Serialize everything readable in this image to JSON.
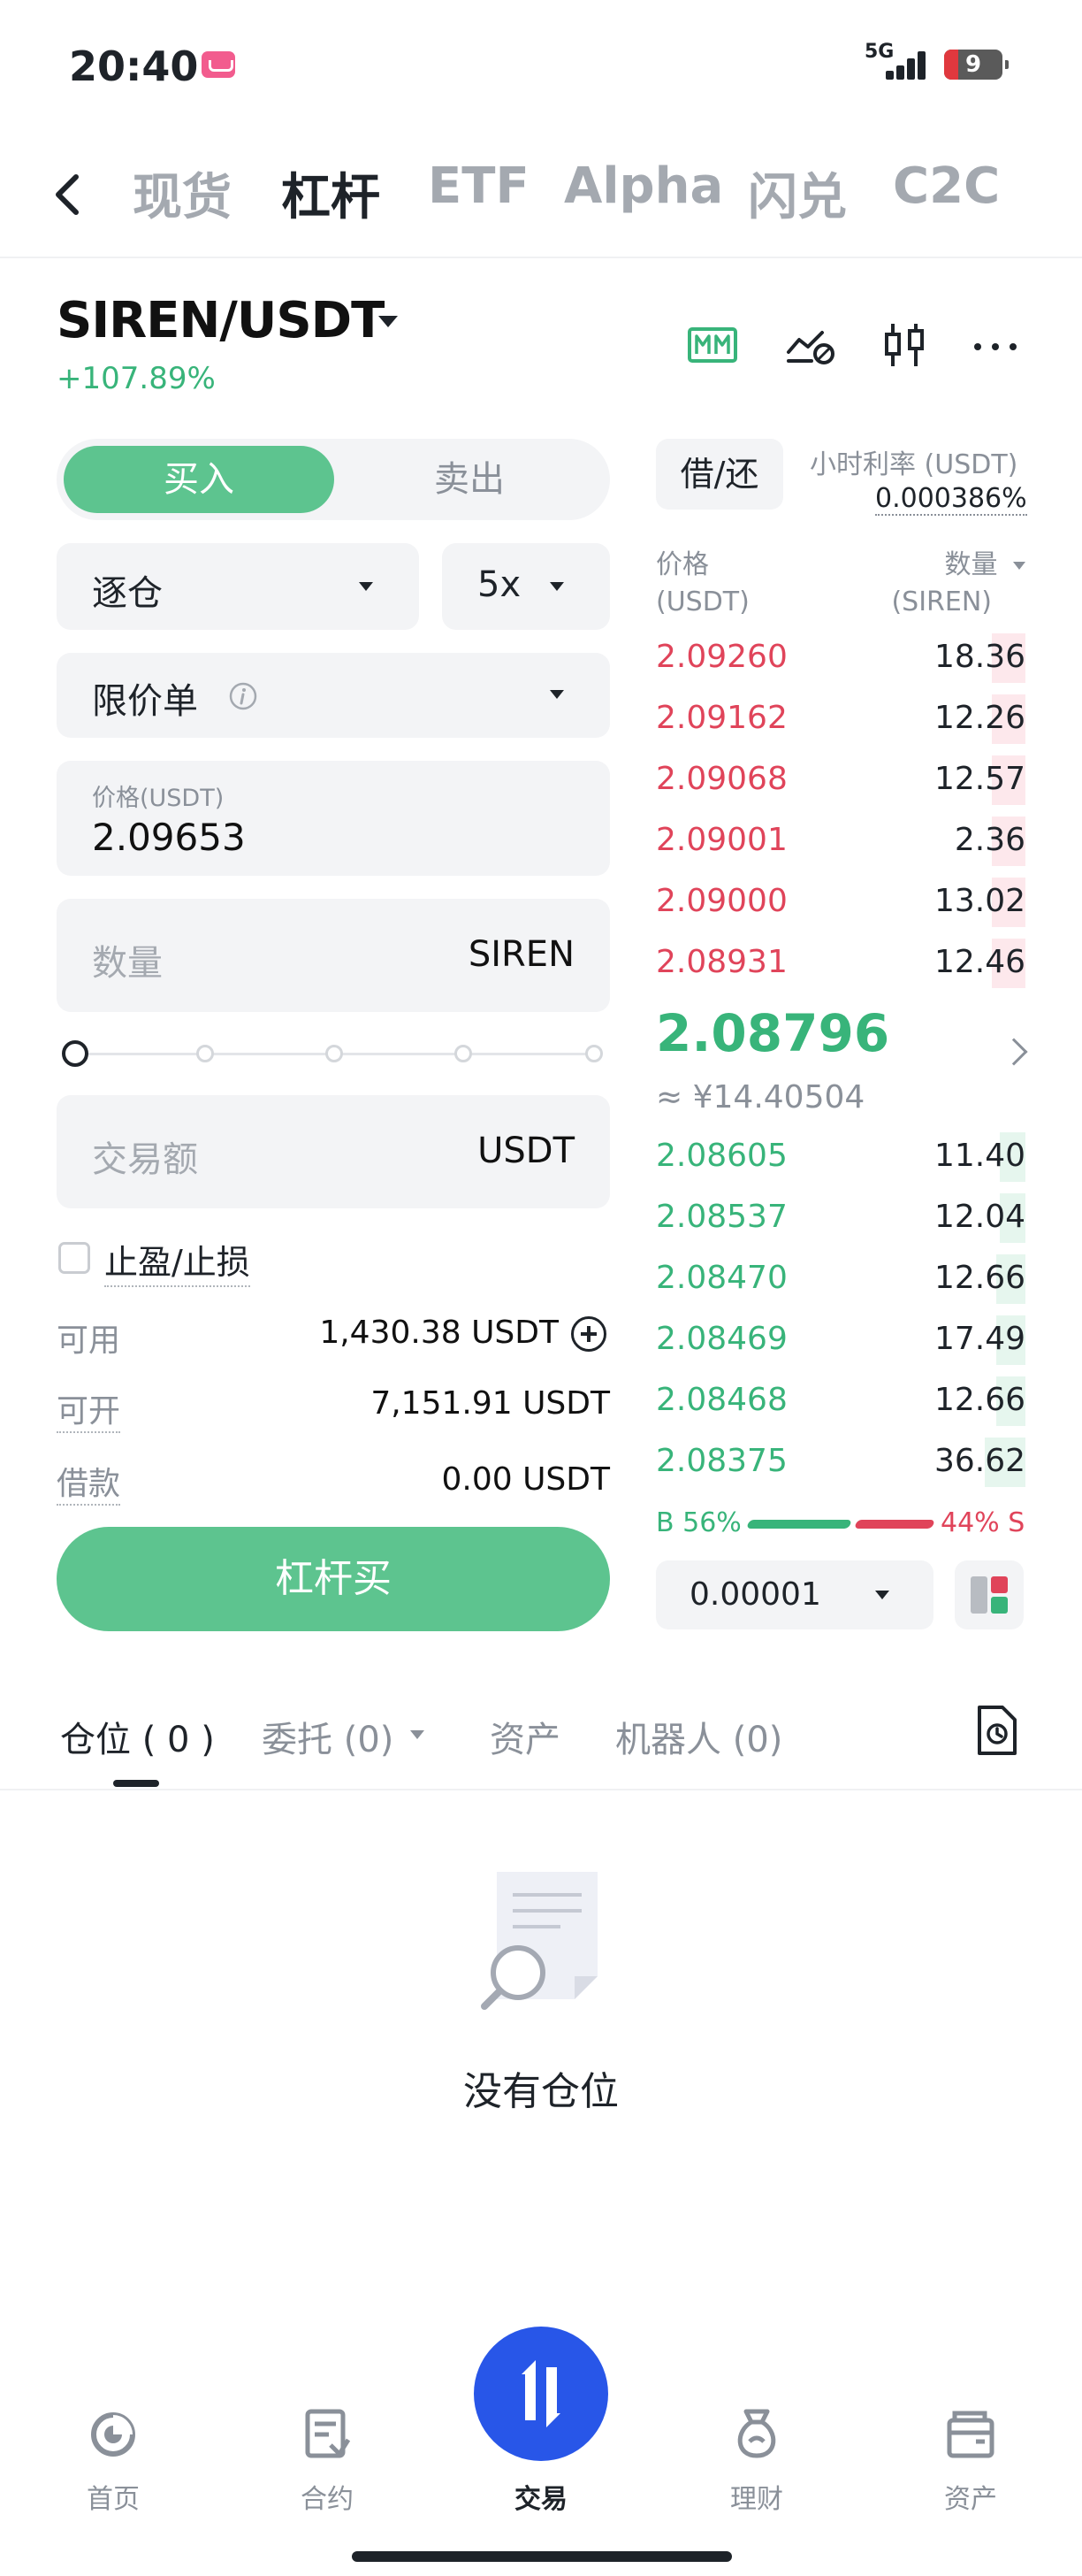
{
  "status_bar": {
    "time": "20:40",
    "network": "5G",
    "battery": "9"
  },
  "top_nav": {
    "tabs": [
      {
        "label": "现货",
        "active": false
      },
      {
        "label": "杠杆",
        "active": true
      },
      {
        "label": "ETF",
        "active": false
      },
      {
        "label": "Alpha",
        "active": false
      },
      {
        "label": "闪兑",
        "active": false
      },
      {
        "label": "C2C",
        "active": false
      }
    ]
  },
  "pair": {
    "symbol": "SIREN/USDT",
    "change": "+107.89%"
  },
  "order_form": {
    "side_buy": "买入",
    "side_sell": "卖出",
    "margin_mode": "逐仓",
    "leverage": "5x",
    "order_type": "限价单",
    "price_label": "价格(USDT)",
    "price_value": "2.09653",
    "qty_placeholder": "数量",
    "qty_unit": "SIREN",
    "amount_placeholder": "交易额",
    "amount_unit": "USDT",
    "tpsl_label": "止盈/止损",
    "available_label": "可用",
    "available_value": "1,430.38 USDT",
    "openable_label": "可开",
    "openable_value": "7,151.91 USDT",
    "loan_label": "借款",
    "loan_value": "0.00 USDT",
    "submit_label": "杠杆买"
  },
  "order_book": {
    "borrow_label": "借/还",
    "rate_label": "小时利率 (USDT)",
    "rate_value": "0.000386%",
    "price_header": "价格",
    "price_header_unit": "(USDT)",
    "qty_header": "数量",
    "qty_header_unit": "(SIREN)",
    "asks": [
      {
        "price": "2.09260",
        "qty": "18.36",
        "depth": 0.09
      },
      {
        "price": "2.09162",
        "qty": "12.26",
        "depth": 0.09
      },
      {
        "price": "2.09068",
        "qty": "12.57",
        "depth": 0.09
      },
      {
        "price": "2.09001",
        "qty": "2.36",
        "depth": 0.09
      },
      {
        "price": "2.09000",
        "qty": "13.02",
        "depth": 0.09
      },
      {
        "price": "2.08931",
        "qty": "12.46",
        "depth": 0.09
      }
    ],
    "mid_price": "2.08796",
    "mid_price_cny": "≈ ¥14.40504",
    "bids": [
      {
        "price": "2.08605",
        "qty": "11.40",
        "depth": 0.07
      },
      {
        "price": "2.08537",
        "qty": "12.04",
        "depth": 0.07
      },
      {
        "price": "2.08470",
        "qty": "12.66",
        "depth": 0.08
      },
      {
        "price": "2.08469",
        "qty": "17.49",
        "depth": 0.08
      },
      {
        "price": "2.08468",
        "qty": "12.66",
        "depth": 0.08
      },
      {
        "price": "2.08375",
        "qty": "36.62",
        "depth": 0.11
      }
    ],
    "buy_ratio": "B 56%",
    "sell_ratio": "44% S",
    "precision": "0.00001"
  },
  "bottom_tabs": {
    "positions": "仓位 ( 0 )",
    "orders": "委托 (0)",
    "assets": "资产",
    "bots": "机器人 (0)"
  },
  "empty_state": {
    "text": "没有仓位"
  },
  "bottom_nav": {
    "items": [
      {
        "label": "首页",
        "icon": "home-icon"
      },
      {
        "label": "合约",
        "icon": "futures-icon"
      },
      {
        "label": "交易",
        "icon": "trade-icon"
      },
      {
        "label": "理财",
        "icon": "earn-icon"
      },
      {
        "label": "资产",
        "icon": "wallet-icon"
      }
    ]
  },
  "colors": {
    "green": "#38b47a",
    "buy_button": "#5dc48f",
    "red": "#e0445a",
    "trade_blue": "#2856e8"
  }
}
